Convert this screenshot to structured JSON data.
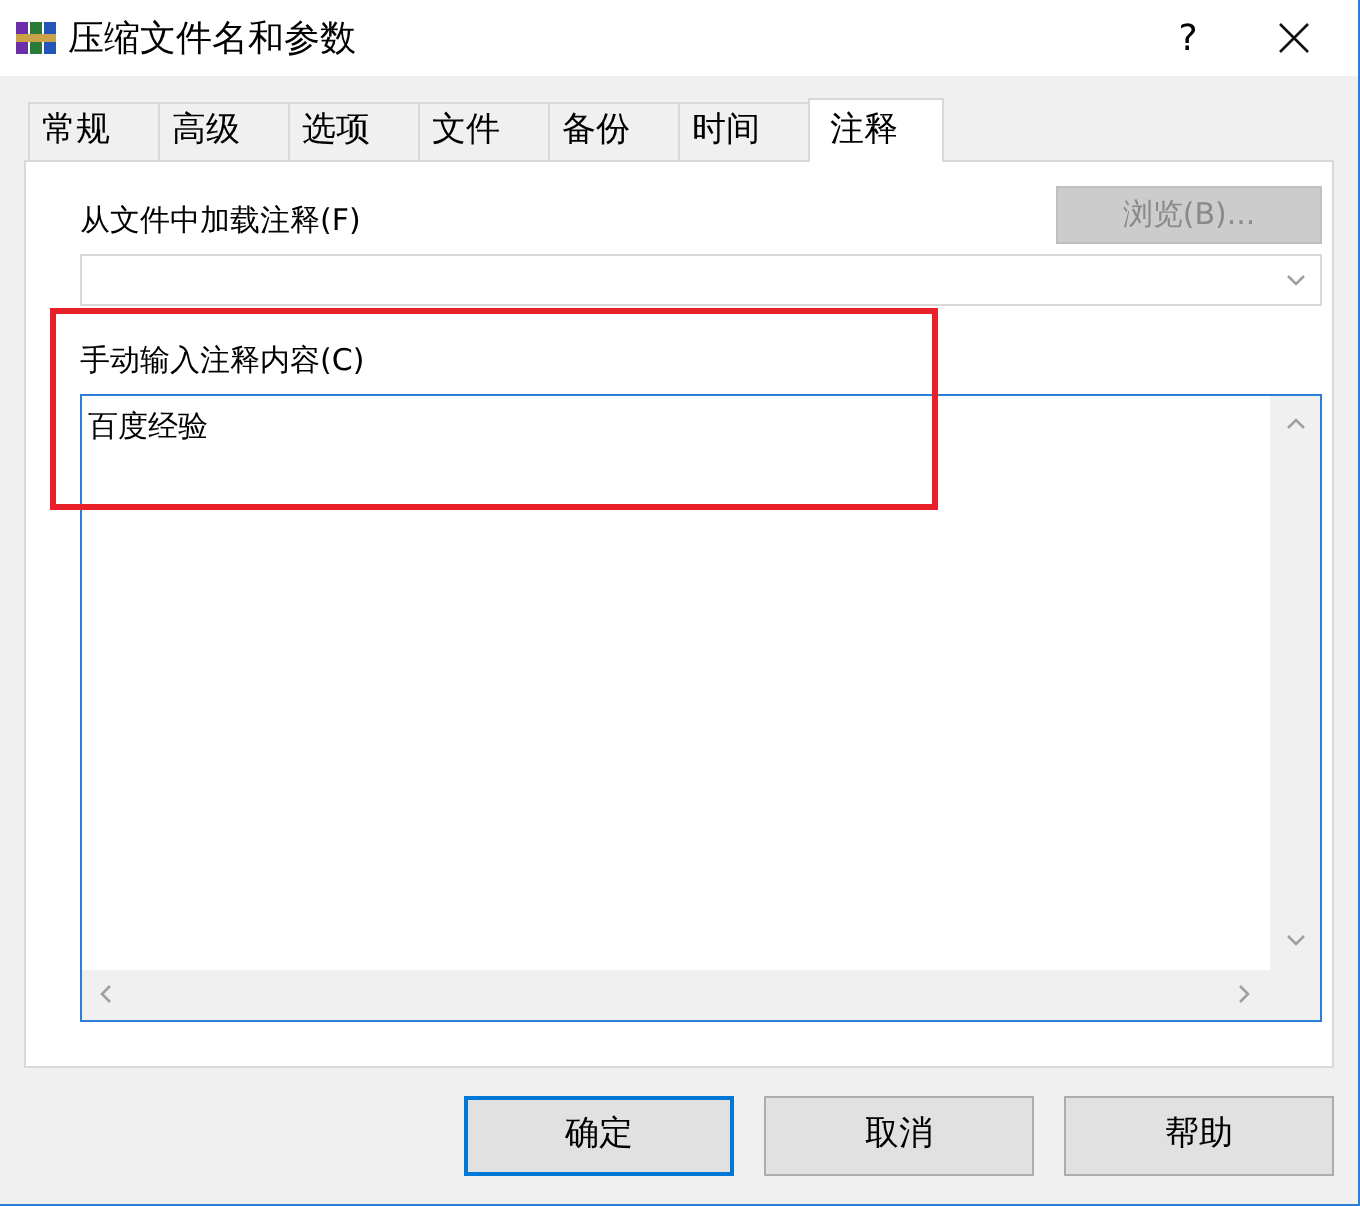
{
  "window": {
    "title": "压缩文件名和参数",
    "help": "?"
  },
  "tabs": [
    {
      "label": "常规",
      "selected": false
    },
    {
      "label": "高级",
      "selected": false
    },
    {
      "label": "选项",
      "selected": false
    },
    {
      "label": "文件",
      "selected": false
    },
    {
      "label": "备份",
      "selected": false
    },
    {
      "label": "时间",
      "selected": false
    },
    {
      "label": "注释",
      "selected": true
    }
  ],
  "load_label": "从文件中加载注释(F)",
  "browse_button": {
    "label": "浏览(B)...",
    "disabled": true
  },
  "file_combo": {
    "disabled": true
  },
  "manual_label": "手动输入注释内容(C)",
  "comment": {
    "value": "百度经验"
  },
  "annotation": {
    "kind": "highlight-box"
  },
  "buttons": [
    {
      "label": "确定",
      "default": true
    },
    {
      "label": "取消",
      "default": false
    },
    {
      "label": "帮助",
      "default": false
    }
  ]
}
